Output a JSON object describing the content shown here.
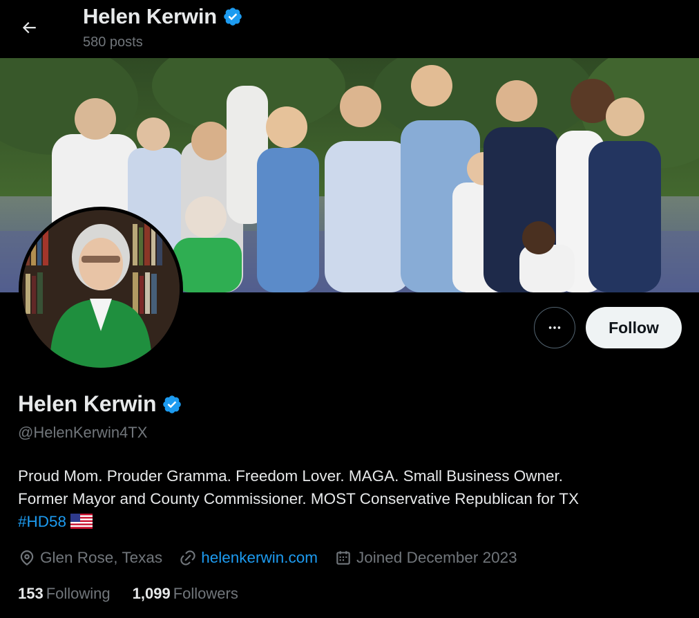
{
  "header": {
    "name": "Helen Kerwin",
    "posts_count": "580 posts",
    "back_icon": "arrow-left-icon"
  },
  "profile": {
    "display_name": "Helen Kerwin",
    "verified_icon": "verified-badge-icon",
    "handle": "@HelenKerwin4TX",
    "bio_line1": "Proud Mom. Prouder Gramma. Freedom Lover. MAGA. Small Business Owner.",
    "bio_line2": "Former Mayor and County Commissioner. MOST Conservative Republican for TX",
    "bio_hashtag": "#HD58",
    "bio_flag": "us-flag-emoji",
    "location": "Glen Rose, Texas",
    "website": "helenkerwin.com",
    "joined": "Joined December 2023"
  },
  "actions": {
    "more_icon": "more-horizontal-icon",
    "follow_label": "Follow"
  },
  "stats": {
    "following_count": "153",
    "following_label": "Following",
    "followers_count": "1,099",
    "followers_label": "Followers"
  },
  "colors": {
    "background": "#000000",
    "text": "#e7e9ea",
    "secondary": "#71767b",
    "accent": "#1d9bf0",
    "follow_bg": "#eff3f4"
  }
}
